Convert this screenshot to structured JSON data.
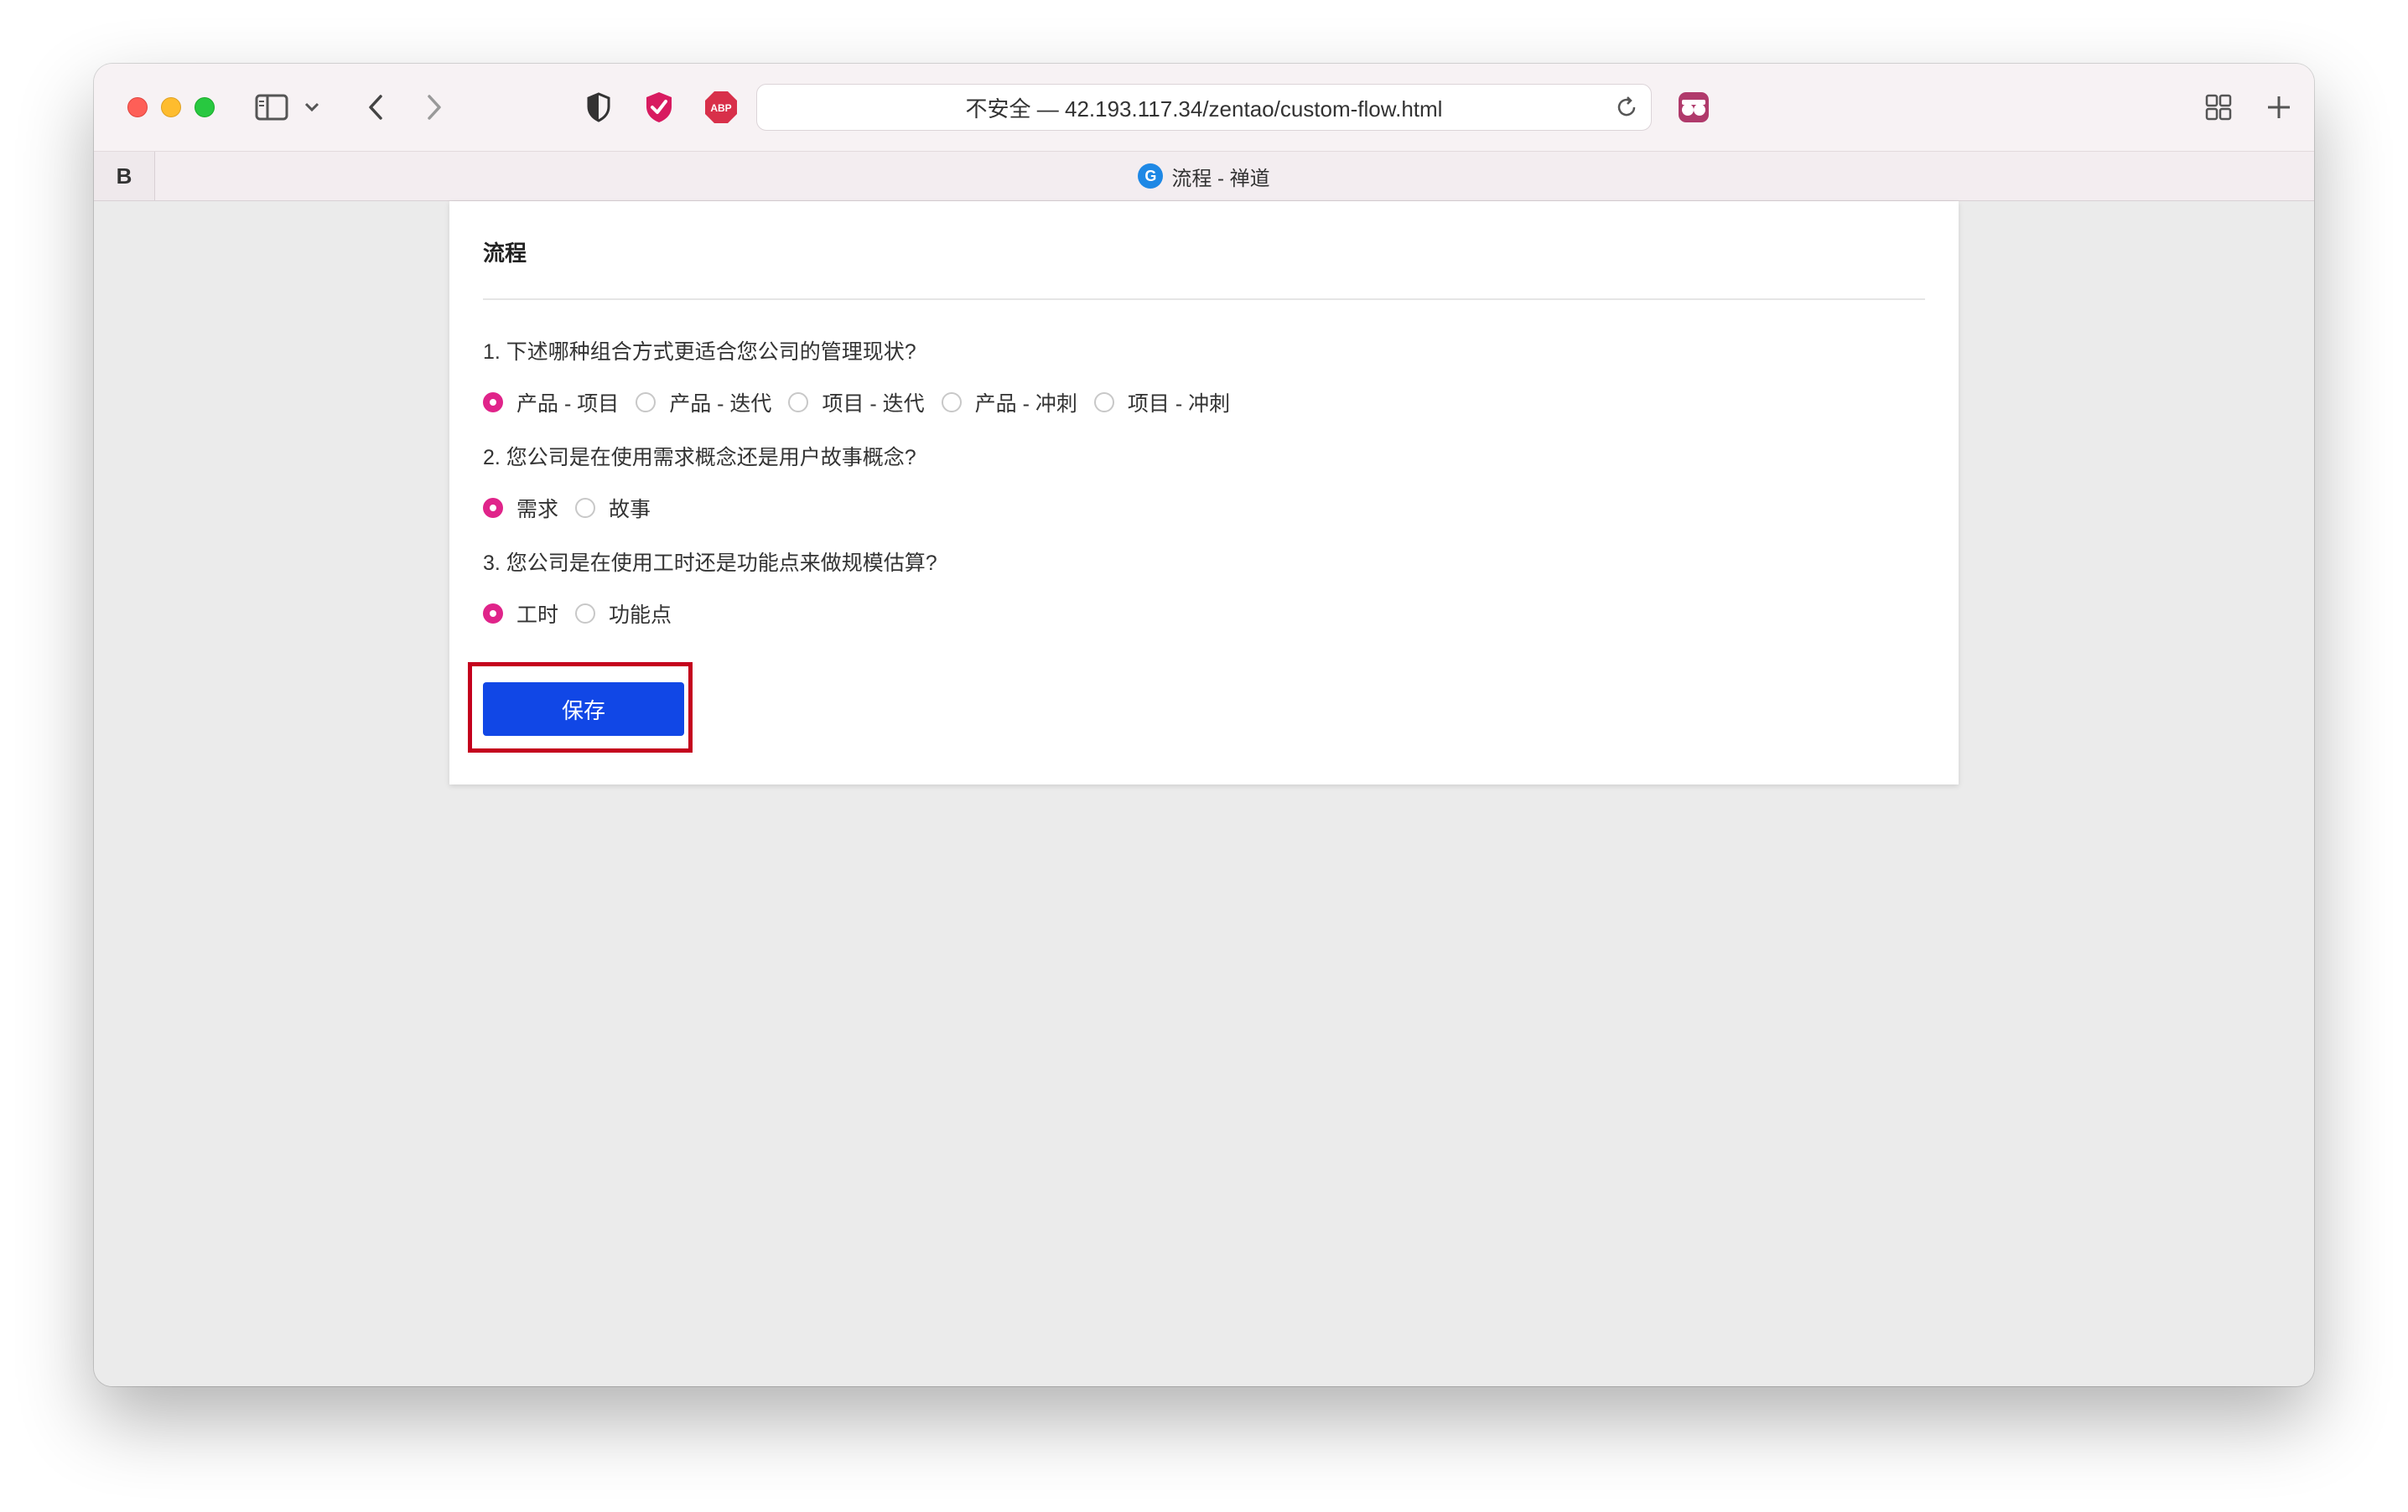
{
  "browser": {
    "url_text": "不安全 — 42.193.117.34/zentao/custom-flow.html",
    "tab_label_left": "B",
    "tab_title": "流程 - 禅道",
    "ext_abp_label": "ABP",
    "favicon_letter": "G"
  },
  "page": {
    "title": "流程",
    "questions": [
      {
        "text": "1. 下述哪种组合方式更适合您公司的管理现状?",
        "options": [
          "产品 - 项目",
          "产品 - 迭代",
          "项目 - 迭代",
          "产品 - 冲刺",
          "项目 - 冲刺"
        ],
        "selected": 0
      },
      {
        "text": "2. 您公司是在使用需求概念还是用户故事概念?",
        "options": [
          "需求",
          "故事"
        ],
        "selected": 0
      },
      {
        "text": "3. 您公司是在使用工时还是功能点来做规模估算?",
        "options": [
          "工时",
          "功能点"
        ],
        "selected": 0
      }
    ],
    "save_label": "保存"
  },
  "colors": {
    "accent_radio": "#e0248a",
    "save_button": "#1147e6",
    "highlight_box": "#c4001d"
  }
}
